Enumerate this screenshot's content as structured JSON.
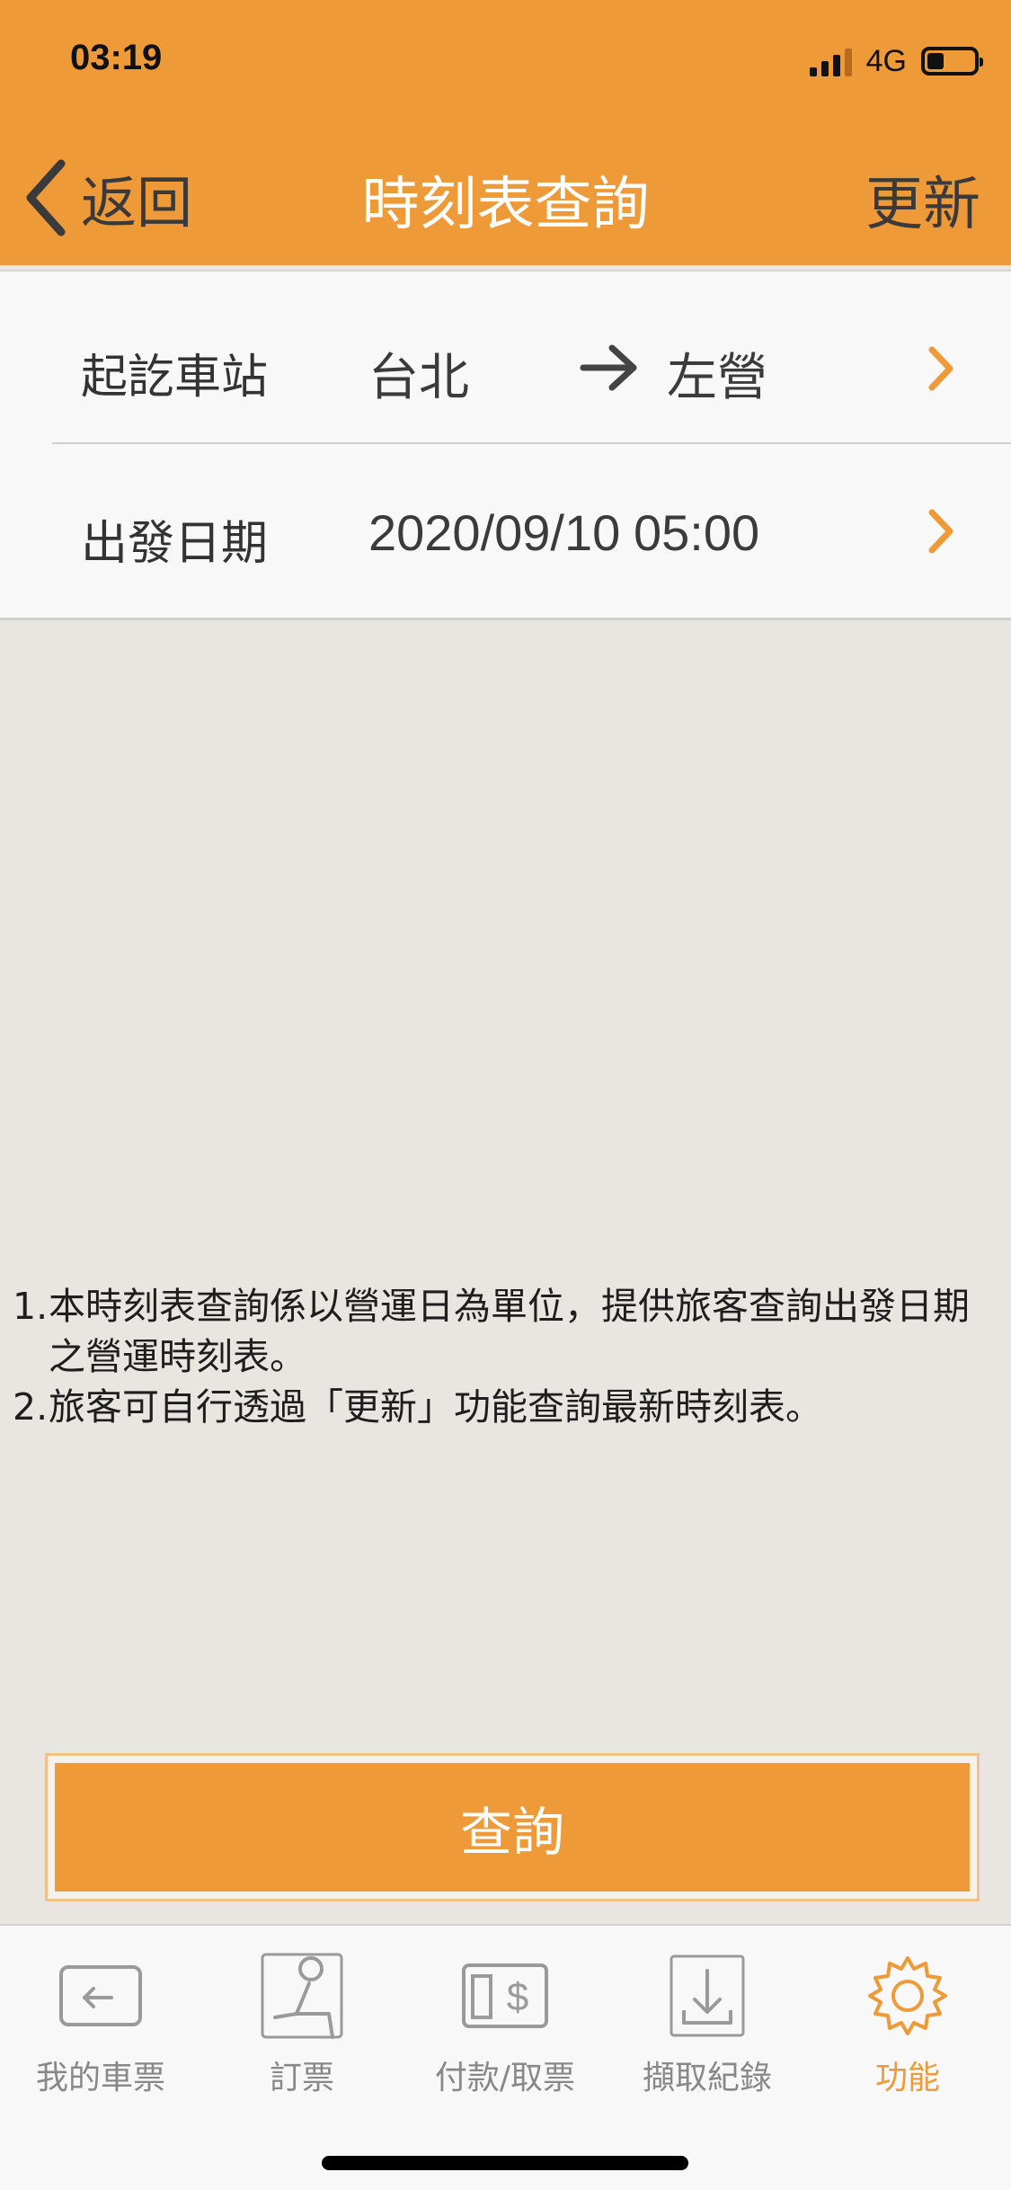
{
  "status_bar": {
    "time": "03:19",
    "network": "4G"
  },
  "nav": {
    "back_label": "返回",
    "title": "時刻表查詢",
    "refresh_label": "更新"
  },
  "form": {
    "station_label": "起訖車站",
    "origin": "台北",
    "destination": "左營",
    "date_label": "出發日期",
    "date": "2020/09/10",
    "time": "05:00"
  },
  "notes": [
    {
      "num": "1.",
      "text": "本時刻表查詢係以營運日為單位，提供旅客查詢出發日期之營運時刻表。"
    },
    {
      "num": "2.",
      "text": "旅客可自行透過「更新」功能查詢最新時刻表。"
    }
  ],
  "query_button": "查詢",
  "tabs": [
    {
      "label": "我的車票",
      "icon": "ticket-icon"
    },
    {
      "label": "訂票",
      "icon": "seat-icon"
    },
    {
      "label": "付款/取票",
      "icon": "payment-icon"
    },
    {
      "label": "擷取紀錄",
      "icon": "download-icon"
    },
    {
      "label": "功能",
      "icon": "gear-icon",
      "active": true
    }
  ],
  "colors": {
    "accent": "#ef9a38",
    "tab_inactive": "#888888"
  }
}
